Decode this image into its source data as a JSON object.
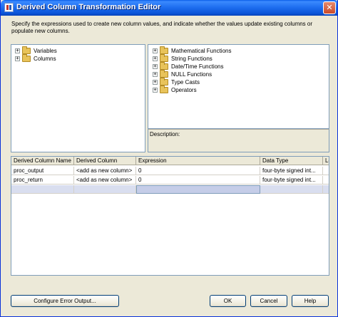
{
  "window": {
    "title": "Derived Column Transformation Editor",
    "close_glyph": "✕"
  },
  "instructions": "Specify the expressions used to create new column values, and indicate whether the values update existing columns or populate new columns.",
  "left_tree": {
    "items": [
      {
        "label": "Variables",
        "expander": "+",
        "icon": "folder-icon"
      },
      {
        "label": "Columns",
        "expander": "+",
        "icon": "folder-icon"
      }
    ]
  },
  "right_tree": {
    "items": [
      {
        "label": "Mathematical Functions",
        "expander": "+",
        "icon": "folder-icon"
      },
      {
        "label": "String Functions",
        "expander": "+",
        "icon": "folder-icon"
      },
      {
        "label": "Date/Time Functions",
        "expander": "+",
        "icon": "folder-icon"
      },
      {
        "label": "NULL Functions",
        "expander": "+",
        "icon": "folder-icon"
      },
      {
        "label": "Type Casts",
        "expander": "+",
        "icon": "folder-icon"
      },
      {
        "label": "Operators",
        "expander": "+",
        "icon": "folder-icon"
      }
    ]
  },
  "description_pane": {
    "label": "Description:"
  },
  "grid": {
    "columns": [
      "Derived Column Name",
      "Derived Column",
      "Expression",
      "Data Type",
      "Le"
    ],
    "rows": [
      [
        "proc_output",
        "<add as new column>",
        "0",
        "four-byte signed int...",
        ""
      ],
      [
        "proc_return",
        "<add as new column>",
        "0",
        "four-byte signed int...",
        ""
      ]
    ]
  },
  "buttons": {
    "configure_error_output": "Configure Error Output...",
    "ok": "OK",
    "cancel": "Cancel",
    "help": "Help"
  },
  "colors": {
    "titlebar": "#0a54d8",
    "dialog_bg": "#ece9d8",
    "new_row": "#d9deef"
  }
}
